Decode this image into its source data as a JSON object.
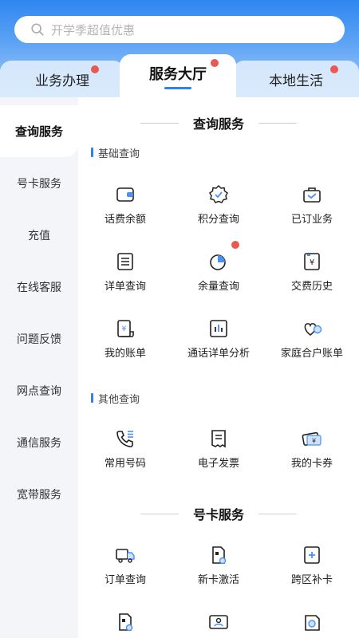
{
  "search": {
    "placeholder": "开学季超值优惠"
  },
  "tabs": [
    {
      "label": "业务办理"
    },
    {
      "label": "服务大厅"
    },
    {
      "label": "本地生活"
    }
  ],
  "sidebar": {
    "items": [
      {
        "label": "查询服务"
      },
      {
        "label": "号卡服务"
      },
      {
        "label": "充值"
      },
      {
        "label": "在线客服"
      },
      {
        "label": "问题反馈"
      },
      {
        "label": "网点查询"
      },
      {
        "label": "通信服务"
      },
      {
        "label": "宽带服务"
      }
    ]
  },
  "query": {
    "title": "查询服务",
    "basic_label": "基础查询",
    "basic": [
      {
        "label": "话费余额",
        "icon": "wallet-icon"
      },
      {
        "label": "积分查询",
        "icon": "badge-check-icon"
      },
      {
        "label": "已订业务",
        "icon": "briefcase-icon"
      },
      {
        "label": "详单查询",
        "icon": "list-icon"
      },
      {
        "label": "余量查询",
        "icon": "pie-chart-icon"
      },
      {
        "label": "交费历史",
        "icon": "yen-receipt-icon"
      },
      {
        "label": "我的账单",
        "icon": "bill-icon"
      },
      {
        "label": "通话详单分析",
        "icon": "bar-chart-icon"
      },
      {
        "label": "家庭合户账单",
        "icon": "family-icon"
      }
    ],
    "other_label": "其他查询",
    "other": [
      {
        "label": "常用号码",
        "icon": "phone-icon"
      },
      {
        "label": "电子发票",
        "icon": "invoice-icon"
      },
      {
        "label": "我的卡券",
        "icon": "coupon-icon"
      }
    ]
  },
  "card": {
    "title": "号卡服务",
    "items": [
      {
        "label": "订单查询",
        "icon": "truck-icon"
      },
      {
        "label": "新卡激活",
        "icon": "sim-activate-icon"
      },
      {
        "label": "跨区补卡",
        "icon": "add-card-icon"
      }
    ]
  },
  "colors": {
    "accent": "#2f7ff5",
    "badge": "#e85a4f",
    "header": "#2f86f0"
  }
}
